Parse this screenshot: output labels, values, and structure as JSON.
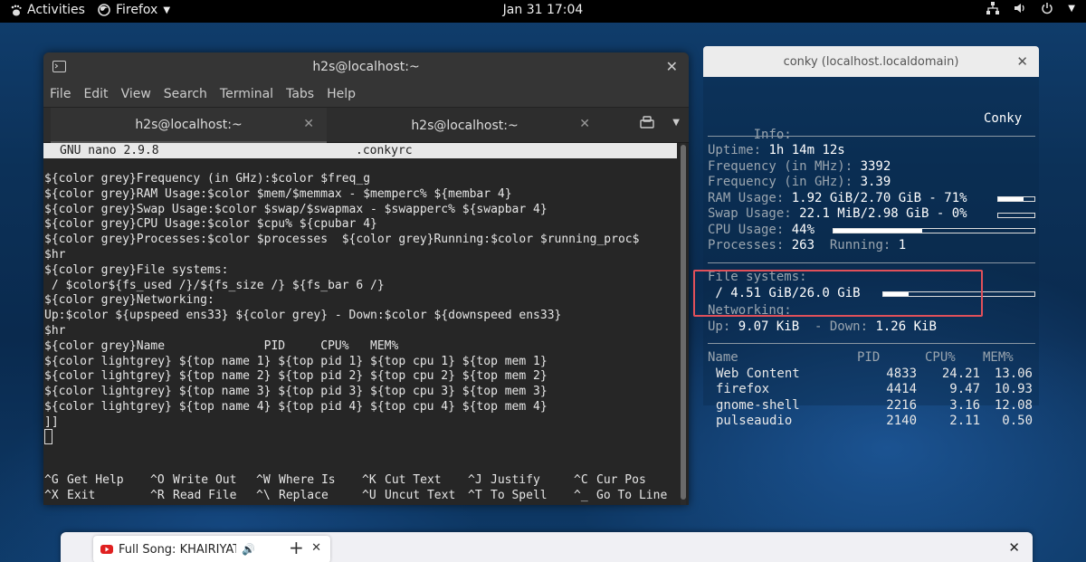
{
  "topbar": {
    "activities": "Activities",
    "app": "Firefox",
    "clock": "Jan 31  17:04"
  },
  "terminal": {
    "title": "h2s@localhost:~",
    "menu": [
      "File",
      "Edit",
      "View",
      "Search",
      "Terminal",
      "Tabs",
      "Help"
    ],
    "tabs": [
      {
        "label": "h2s@localhost:~"
      },
      {
        "label": "h2s@localhost:~"
      }
    ],
    "nano_version": "GNU nano 2.9.8",
    "filename": ".conkyrc",
    "lines": [
      "${color grey}Frequency (in GHz):$color $freq_g",
      "${color grey}RAM Usage:$color $mem/$memmax - $memperc% ${membar 4}",
      "${color grey}Swap Usage:$color $swap/$swapmax - $swapperc% ${swapbar 4}",
      "${color grey}CPU Usage:$color $cpu% ${cpubar 4}",
      "${color grey}Processes:$color $processes  ${color grey}Running:$color $running_proc$",
      "$hr",
      "${color grey}File systems:",
      " / $color${fs_used /}/${fs_size /} ${fs_bar 6 /}",
      "${color grey}Networking:",
      "Up:$color ${upspeed ens33} ${color grey} - Down:$color ${downspeed ens33}",
      "$hr",
      "${color grey}Name              PID     CPU%   MEM%",
      "${color lightgrey} ${top name 1} ${top pid 1} ${top cpu 1} ${top mem 1}",
      "${color lightgrey} ${top name 2} ${top pid 2} ${top cpu 2} ${top mem 2}",
      "${color lightgrey} ${top name 3} ${top pid 3} ${top cpu 3} ${top mem 3}",
      "${color lightgrey} ${top name 4} ${top pid 4} ${top cpu 4} ${top mem 4}",
      "]]"
    ],
    "shortcuts_row1": [
      {
        "key": "^G",
        "label": "Get Help"
      },
      {
        "key": "^O",
        "label": "Write Out"
      },
      {
        "key": "^W",
        "label": "Where Is"
      },
      {
        "key": "^K",
        "label": "Cut Text"
      },
      {
        "key": "^J",
        "label": "Justify"
      },
      {
        "key": "^C",
        "label": "Cur Pos"
      }
    ],
    "shortcuts_row2": [
      {
        "key": "^X",
        "label": "Exit"
      },
      {
        "key": "^R",
        "label": "Read File"
      },
      {
        "key": "^\\",
        "label": "Replace"
      },
      {
        "key": "^U",
        "label": "Uncut Text"
      },
      {
        "key": "^T",
        "label": "To Spell"
      },
      {
        "key": "^_",
        "label": "Go To Line"
      }
    ]
  },
  "conky": {
    "window_title": "conky (localhost.localdomain)",
    "info_label": "Info:",
    "info_value": "Conky",
    "uptime_label": "Uptime: ",
    "uptime": "1h 14m 12s",
    "freq_mhz_label": "Frequency (in MHz): ",
    "freq_mhz": "3392",
    "freq_ghz_label": "Frequency (in GHz): ",
    "freq_ghz": "3.39",
    "ram_label": "RAM Usage: ",
    "ram": "1.92 GiB/2.70 GiB - 71%",
    "ram_fraction": 0.71,
    "swap_label": "Swap Usage: ",
    "swap": "22.1 MiB/2.98 GiB - 0%",
    "swap_fraction": 0.0,
    "cpu_label": "CPU Usage: ",
    "cpu": "44%",
    "cpu_fraction": 0.44,
    "processes_label": "Processes: ",
    "processes": "263",
    "running_label": "  Running: ",
    "running": "1",
    "fs_label": "File systems:",
    "fs": " / 4.51 GiB/26.0 GiB",
    "fs_fraction": 0.17,
    "net_label": "Networking:",
    "up_label": "Up: ",
    "up": "9.07 KiB",
    "down_label": "  - Down: ",
    "down": "1.26 KiB",
    "table_headers": {
      "name": "Name",
      "pid": "PID",
      "cpu": "CPU%",
      "mem": "MEM%"
    },
    "processes_table": [
      {
        "name": "Web Content",
        "pid": "4833",
        "cpu": "24.21",
        "mem": "13.06"
      },
      {
        "name": "firefox",
        "pid": "4414",
        "cpu": "9.47",
        "mem": "10.93"
      },
      {
        "name": "gnome-shell",
        "pid": "2216",
        "cpu": "3.16",
        "mem": "12.08"
      },
      {
        "name": "pulseaudio",
        "pid": "2140",
        "cpu": "2.11",
        "mem": "0.50"
      }
    ]
  },
  "firefox": {
    "tab_title": "Full Song: KHAIRIYAT (",
    "accent": "#e0505a"
  }
}
